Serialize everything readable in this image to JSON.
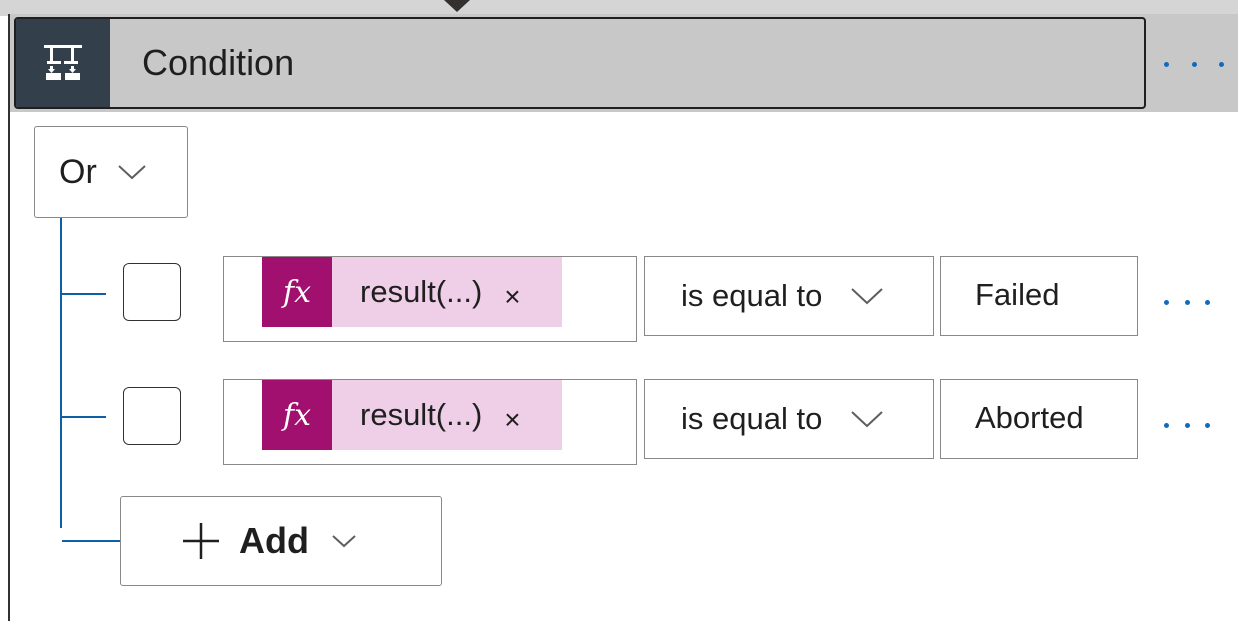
{
  "header": {
    "title": "Condition",
    "icon": "condition-icon",
    "more_icon": "more-dots-icon"
  },
  "group": {
    "operator": "Or"
  },
  "rows": [
    {
      "expression": {
        "fx_label": "fx",
        "label": "result(...)",
        "remove": "×"
      },
      "operator": "is equal to",
      "value": "Failed"
    },
    {
      "expression": {
        "fx_label": "fx",
        "label": "result(...)",
        "remove": "×"
      },
      "operator": "is equal to",
      "value": "Aborted"
    }
  ],
  "add_button": {
    "label": "Add",
    "icon": "plus-icon"
  },
  "colors": {
    "header_bg": "#c8c8c8",
    "icon_box_bg": "#333f4a",
    "fx_bg": "#a1106f",
    "token_bg": "#efcfe7",
    "tree_line": "#0f5fa8",
    "accent_dots": "#0f6cbd"
  }
}
